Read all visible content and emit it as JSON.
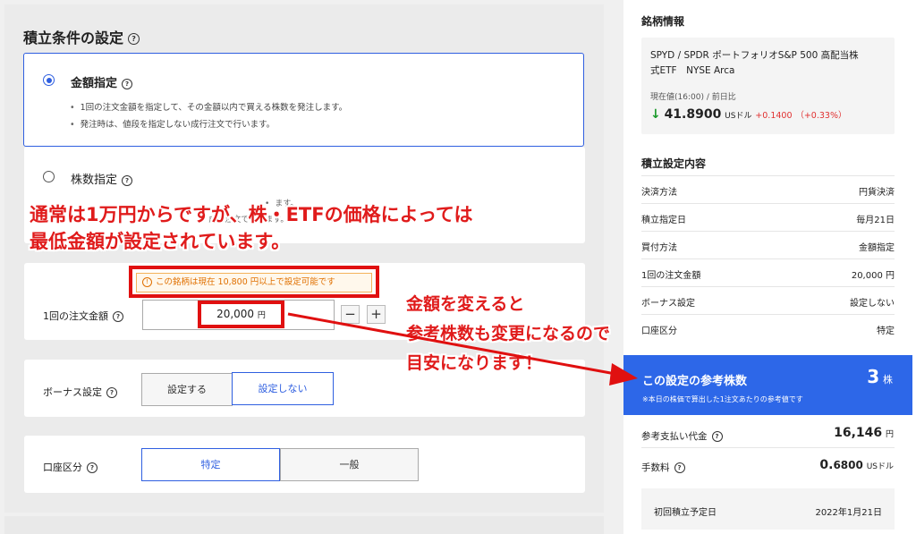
{
  "settings": {
    "title": "積立条件の設定",
    "help_glyph": "?",
    "amount_option": {
      "label": "金額指定",
      "bullets": [
        "1回の注文金額を指定して、その金額以内で買える株数を発注します。",
        "発注時は、値段を指定しない成行注文で行います。"
      ]
    },
    "shares_option": {
      "label": "株数指定",
      "bullets_partial": [
        "ます。",
        "成行注文で行います。"
      ]
    },
    "order_amount": {
      "label": "1回の注文金額",
      "warning_icon": "!",
      "warning": "この銘柄は現在 10,800 円以上で設定可能です",
      "value": "20,000",
      "unit": "円",
      "minus": "−",
      "plus": "+"
    },
    "bonus": {
      "label": "ボーナス設定",
      "options": [
        "設定する",
        "設定しない"
      ],
      "selected": "設定しない"
    },
    "account": {
      "label": "口座区分",
      "options": [
        "特定",
        "一般"
      ],
      "selected": "特定"
    }
  },
  "overlay": {
    "note_line1_pre": "通常は",
    "note_line1_bold": "1",
    "note_line1_post": "万円からですが、株・ETFの価格によっては",
    "note_line2": "最低金額が設定されています。",
    "arrow_note_lines": [
      "金額を変えると",
      "参考株数も変更になるので",
      "目安になります！"
    ],
    "colors": {
      "annotation_red": "#e01b1b",
      "accent_blue": "#2d67e8",
      "warning_orange": "#e07000"
    }
  },
  "stock": {
    "section_title": "銘柄情報",
    "name_line1": "SPYD / SPDR ポートフォリオS&P 500 高配当株",
    "name_line2": "式ETF　NYSE Arca",
    "price_label": "現在値(16:00) / 前日比",
    "arrow": "↓",
    "price": "41.8900",
    "price_unit": "USドル",
    "change": "+0.1400",
    "change_pct": "（+0.33%）"
  },
  "summary": {
    "section_title": "積立設定内容",
    "rows": [
      {
        "k": "決済方法",
        "v": "円貨決済"
      },
      {
        "k": "積立指定日",
        "v": "毎月21日"
      },
      {
        "k": "買付方法",
        "v": "金額指定"
      },
      {
        "k": "1回の注文金額",
        "v": "20,000 円"
      },
      {
        "k": "ボーナス設定",
        "v": "設定しない"
      },
      {
        "k": "口座区分",
        "v": "特定"
      }
    ]
  },
  "reference": {
    "title": "この設定の参考株数",
    "count": "3",
    "unit": "株",
    "note": "※本日の株価で算出した1注文あたりの参考値です"
  },
  "costs": {
    "payment_label": "参考支払い代金",
    "payment_value": "16,146",
    "payment_unit": "円",
    "fee_label": "手数料",
    "fee_value_bold": "0.",
    "fee_value": "6800",
    "fee_unit": "USドル",
    "first_label": "初回積立予定日",
    "first_value": "2022年1月21日"
  }
}
